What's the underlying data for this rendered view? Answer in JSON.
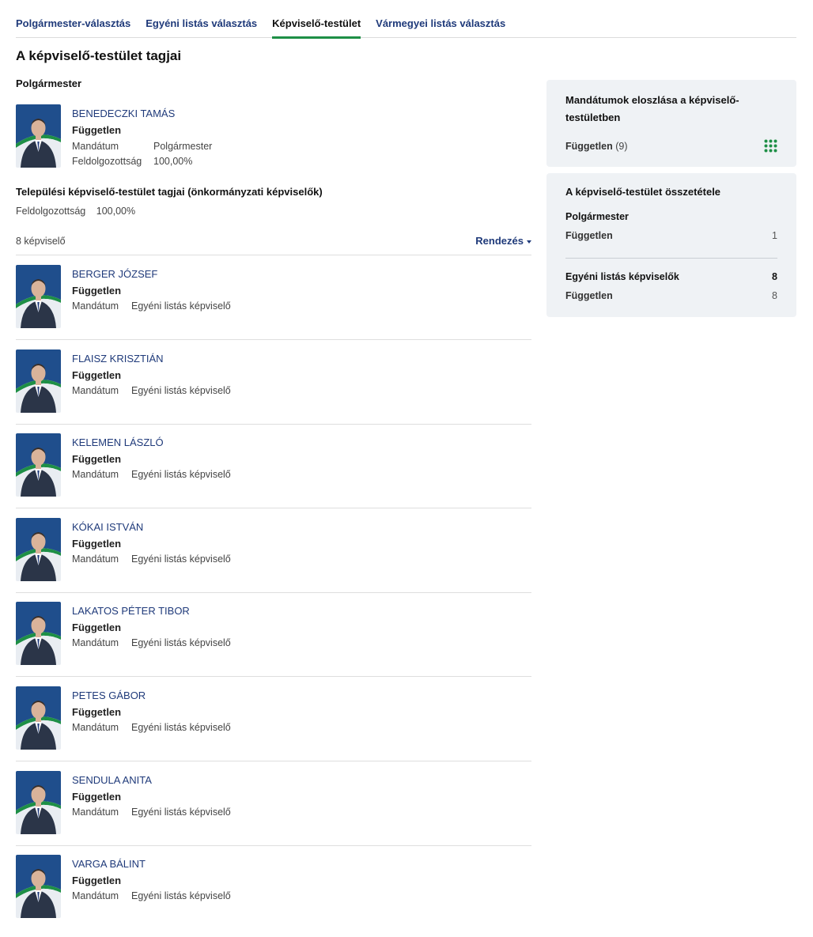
{
  "tabs": [
    {
      "label": "Polgármester-választás",
      "active": false
    },
    {
      "label": "Egyéni listás választás",
      "active": false
    },
    {
      "label": "Képviselő-testület",
      "active": true
    },
    {
      "label": "Vármegyei listás választás",
      "active": false
    }
  ],
  "page_title": "A képviselő-testület tagjai",
  "mayor_section": {
    "heading": "Polgármester",
    "name": "BENEDECZKI TAMÁS",
    "party": "Független",
    "mandate_label": "Mandátum",
    "mandate_value": "Polgármester",
    "processed_label": "Feldolgozottság",
    "processed_value": "100,00%"
  },
  "council_section": {
    "heading": "Települési képviselő-testület tagjai (önkormányzati képviselők)",
    "processed_label": "Feldolgozottság",
    "processed_value": "100,00%",
    "count_text": "8 képviselő",
    "sort_label": "Rendezés"
  },
  "members": [
    {
      "name": "BERGER JÓZSEF",
      "party": "Független",
      "mandate_label": "Mandátum",
      "mandate_value": "Egyéni listás képviselő"
    },
    {
      "name": "FLAISZ KRISZTIÁN",
      "party": "Független",
      "mandate_label": "Mandátum",
      "mandate_value": "Egyéni listás képviselő"
    },
    {
      "name": "KELEMEN LÁSZLÓ",
      "party": "Független",
      "mandate_label": "Mandátum",
      "mandate_value": "Egyéni listás képviselő"
    },
    {
      "name": "KÓKAI ISTVÁN",
      "party": "Független",
      "mandate_label": "Mandátum",
      "mandate_value": "Egyéni listás képviselő"
    },
    {
      "name": "LAKATOS PÉTER TIBOR",
      "party": "Független",
      "mandate_label": "Mandátum",
      "mandate_value": "Egyéni listás képviselő"
    },
    {
      "name": "PETES GÁBOR",
      "party": "Független",
      "mandate_label": "Mandátum",
      "mandate_value": "Egyéni listás képviselő"
    },
    {
      "name": "SENDULA ANITA",
      "party": "Független",
      "mandate_label": "Mandátum",
      "mandate_value": "Egyéni listás képviselő"
    },
    {
      "name": "VARGA BÁLINT",
      "party": "Független",
      "mandate_label": "Mandátum",
      "mandate_value": "Egyéni listás képviselő"
    }
  ],
  "distribution_panel": {
    "title": "Mandátumok eloszlása a képviselő-testületben",
    "party": "Független",
    "count": "(9)",
    "icon": "grid-dots-icon",
    "icon_color": "#1e8f46"
  },
  "composition_panel": {
    "title": "A képviselő-testület összetétele",
    "mayor_heading": "Polgármester",
    "mayor_party": "Független",
    "mayor_count": "1",
    "list_heading": "Egyéni listás képviselők",
    "list_total": "8",
    "list_party": "Független",
    "list_count": "8"
  },
  "colors": {
    "link": "#1f3a7a",
    "accent_green": "#1e8f46",
    "panel_bg": "#eff2f5",
    "photo_bg": "#1f4e8c"
  }
}
